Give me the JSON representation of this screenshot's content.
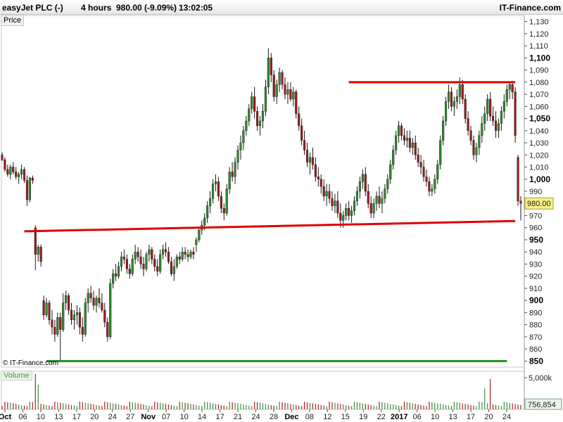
{
  "header": {
    "instrument": "easyJet PLC (-)",
    "timeframe": "4 hours",
    "quote": "980.00 (-9.09%)",
    "time": "13:02:05",
    "brand": "IT-Finance.com"
  },
  "panels": {
    "price_label": "Price",
    "volume_label": "Volume"
  },
  "copyright": "© IT-Finance.com",
  "colors": {
    "up": "#2f8a2f",
    "down": "#9b1c1c",
    "resistance": "#e00000",
    "support_green": "#1f8f1f",
    "current_price_box": "#f7f08a",
    "volume_box": "#eaf5ea"
  },
  "chart_data": {
    "type": "candlestick",
    "price_axis": {
      "min": 845,
      "max": 1135,
      "ticks": [
        850,
        860,
        870,
        880,
        890,
        900,
        910,
        920,
        930,
        940,
        950,
        960,
        970,
        980,
        990,
        1000,
        1010,
        1020,
        1030,
        1040,
        1050,
        1060,
        1070,
        1080,
        1090,
        1100,
        1110,
        1120,
        1130
      ],
      "tick_labels": [
        "850",
        "860",
        "870",
        "880",
        "890",
        "900",
        "910",
        "920",
        "930",
        "940",
        "950",
        "960",
        "970",
        "980",
        "990",
        "1,000",
        "1,010",
        "1,020",
        "1,030",
        "1,040",
        "1,050",
        "1,060",
        "1,070",
        "1,080",
        "1,090",
        "1,100",
        "1,110",
        "1,120",
        "1,130"
      ],
      "bold_ticks": [
        850,
        900,
        950,
        1000,
        1050,
        1100
      ]
    },
    "current_price": {
      "value": 980.0,
      "label": "980.00"
    },
    "date_axis": {
      "labels": [
        "Oct",
        "06",
        "10",
        "13",
        "17",
        "20",
        "24",
        "27",
        "Nov",
        "07",
        "10",
        "14",
        "17",
        "21",
        "24",
        "28",
        "Dec",
        "08",
        "12",
        "15",
        "19",
        "22",
        "2017",
        "06",
        "10",
        "13",
        "17",
        "20",
        "24"
      ],
      "bold": [
        "Oct",
        "Nov",
        "Dec",
        "2017"
      ]
    },
    "volume": {
      "axis_label": "5,000k",
      "current_label": "756,854",
      "max": 6000000
    },
    "trendlines": [
      {
        "name": "resistance",
        "color": "#e00000",
        "from": {
          "bar": 125,
          "price": 1080
        },
        "to": {
          "bar": 185,
          "price": 1080
        }
      },
      {
        "name": "support",
        "color": "#e00000",
        "from": {
          "bar": 8,
          "price": 957
        },
        "to": {
          "bar": 185,
          "price": 965.5
        }
      },
      {
        "name": "low-line",
        "color": "#1f8f1f",
        "from": {
          "bar": 16,
          "price": 850
        },
        "to": {
          "bar": 182,
          "price": 850
        }
      }
    ],
    "candles": [
      [
        1020,
        1022,
        1015,
        1016
      ],
      [
        1016,
        1018,
        1006,
        1008
      ],
      [
        1008,
        1012,
        1002,
        1004
      ],
      [
        1004,
        1012,
        1000,
        1010
      ],
      [
        1010,
        1014,
        1004,
        1006
      ],
      [
        1006,
        1010,
        1000,
        1002
      ],
      [
        1002,
        1006,
        996,
        1004
      ],
      [
        1004,
        1012,
        1000,
        1008
      ],
      [
        1008,
        1010,
        997,
        999
      ],
      [
        999,
        1003,
        978,
        983
      ],
      [
        983,
        1002,
        981,
        1001
      ],
      [
        1001,
        1003,
        996,
        999
      ],
      [
        960,
        962,
        925,
        938
      ],
      [
        938,
        946,
        932,
        944
      ],
      [
        944,
        946,
        928,
        932
      ],
      [
        900,
        904,
        884,
        888
      ],
      [
        888,
        902,
        886,
        898
      ],
      [
        898,
        900,
        880,
        884
      ],
      [
        884,
        892,
        872,
        878
      ],
      [
        878,
        884,
        866,
        872
      ],
      [
        872,
        890,
        870,
        886
      ],
      [
        886,
        890,
        850,
        876
      ],
      [
        876,
        906,
        874,
        898
      ],
      [
        898,
        908,
        892,
        904
      ],
      [
        904,
        906,
        888,
        892
      ],
      [
        892,
        898,
        880,
        884
      ],
      [
        884,
        892,
        876,
        888
      ],
      [
        888,
        896,
        880,
        890
      ],
      [
        890,
        894,
        872,
        878
      ],
      [
        878,
        886,
        866,
        872
      ],
      [
        872,
        902,
        870,
        898
      ],
      [
        898,
        910,
        890,
        906
      ],
      [
        906,
        912,
        898,
        902
      ],
      [
        902,
        908,
        892,
        896
      ],
      [
        896,
        904,
        890,
        902
      ],
      [
        902,
        910,
        894,
        898
      ],
      [
        898,
        906,
        890,
        892
      ],
      [
        892,
        898,
        878,
        882
      ],
      [
        882,
        886,
        866,
        870
      ],
      [
        870,
        918,
        868,
        914
      ],
      [
        914,
        926,
        910,
        922
      ],
      [
        922,
        930,
        916,
        920
      ],
      [
        920,
        932,
        918,
        928
      ],
      [
        928,
        940,
        924,
        936
      ],
      [
        936,
        942,
        930,
        934
      ],
      [
        934,
        938,
        922,
        926
      ],
      [
        926,
        930,
        918,
        922
      ],
      [
        922,
        938,
        920,
        934
      ],
      [
        934,
        946,
        930,
        940
      ],
      [
        940,
        944,
        932,
        936
      ],
      [
        936,
        942,
        926,
        930
      ],
      [
        930,
        936,
        920,
        926
      ],
      [
        926,
        940,
        924,
        938
      ],
      [
        938,
        946,
        932,
        942
      ],
      [
        942,
        944,
        930,
        934
      ],
      [
        934,
        938,
        924,
        928
      ],
      [
        928,
        934,
        920,
        924
      ],
      [
        924,
        942,
        922,
        938
      ],
      [
        938,
        946,
        934,
        942
      ],
      [
        942,
        948,
        936,
        940
      ],
      [
        940,
        944,
        930,
        932
      ],
      [
        932,
        936,
        920,
        922
      ],
      [
        922,
        934,
        916,
        928
      ],
      [
        928,
        938,
        926,
        936
      ],
      [
        936,
        940,
        930,
        934
      ],
      [
        934,
        944,
        932,
        940
      ],
      [
        940,
        944,
        934,
        938
      ],
      [
        938,
        942,
        932,
        936
      ],
      [
        936,
        942,
        934,
        940
      ],
      [
        940,
        944,
        934,
        938
      ],
      [
        946,
        952,
        940,
        950
      ],
      [
        950,
        960,
        948,
        958
      ],
      [
        958,
        966,
        954,
        962
      ],
      [
        962,
        972,
        958,
        968
      ],
      [
        968,
        982,
        964,
        978
      ],
      [
        978,
        990,
        972,
        984
      ],
      [
        984,
        1000,
        980,
        996
      ],
      [
        996,
        1004,
        990,
        998
      ],
      [
        998,
        1002,
        982,
        986
      ],
      [
        986,
        990,
        972,
        976
      ],
      [
        976,
        980,
        966,
        972
      ],
      [
        972,
        996,
        970,
        992
      ],
      [
        992,
        1010,
        988,
        1006
      ],
      [
        1006,
        1014,
        998,
        1002
      ],
      [
        1002,
        1018,
        996,
        1014
      ],
      [
        1014,
        1028,
        1008,
        1024
      ],
      [
        1024,
        1036,
        1016,
        1030
      ],
      [
        1030,
        1044,
        1024,
        1040
      ],
      [
        1040,
        1052,
        1036,
        1048
      ],
      [
        1048,
        1062,
        1044,
        1058
      ],
      [
        1058,
        1072,
        1054,
        1068
      ],
      [
        1068,
        1076,
        1050,
        1056
      ],
      [
        1056,
        1060,
        1040,
        1044
      ],
      [
        1044,
        1052,
        1036,
        1048
      ],
      [
        1048,
        1062,
        1042,
        1056
      ],
      [
        1056,
        1082,
        1052,
        1076
      ],
      [
        1076,
        1108,
        1070,
        1100
      ],
      [
        1100,
        1104,
        1080,
        1086
      ],
      [
        1086,
        1090,
        1064,
        1068
      ],
      [
        1068,
        1082,
        1062,
        1078
      ],
      [
        1078,
        1092,
        1072,
        1088
      ],
      [
        1088,
        1090,
        1074,
        1078
      ],
      [
        1078,
        1084,
        1066,
        1070
      ],
      [
        1070,
        1080,
        1062,
        1074
      ],
      [
        1074,
        1080,
        1064,
        1066
      ],
      [
        1066,
        1076,
        1060,
        1072
      ],
      [
        1072,
        1074,
        1050,
        1054
      ],
      [
        1054,
        1060,
        1040,
        1044
      ],
      [
        1044,
        1050,
        1028,
        1032
      ],
      [
        1032,
        1040,
        1020,
        1024
      ],
      [
        1024,
        1030,
        1010,
        1014
      ],
      [
        1014,
        1022,
        1004,
        1018
      ],
      [
        1018,
        1026,
        1008,
        1012
      ],
      [
        1012,
        1018,
        998,
        1002
      ],
      [
        1002,
        1010,
        994,
        1000
      ],
      [
        1000,
        1004,
        988,
        994
      ],
      [
        994,
        1000,
        982,
        986
      ],
      [
        986,
        996,
        978,
        990
      ],
      [
        990,
        996,
        980,
        984
      ],
      [
        984,
        990,
        974,
        978
      ],
      [
        978,
        988,
        972,
        982
      ],
      [
        982,
        990,
        968,
        972
      ],
      [
        972,
        980,
        960,
        966
      ],
      [
        966,
        974,
        960,
        970
      ],
      [
        970,
        980,
        966,
        976
      ],
      [
        976,
        982,
        966,
        970
      ],
      [
        970,
        978,
        964,
        974
      ],
      [
        974,
        986,
        970,
        982
      ],
      [
        982,
        994,
        978,
        990
      ],
      [
        990,
        1002,
        984,
        998
      ],
      [
        998,
        1008,
        992,
        1004
      ],
      [
        1004,
        1010,
        986,
        990
      ],
      [
        990,
        996,
        976,
        980
      ],
      [
        980,
        986,
        968,
        972
      ],
      [
        972,
        984,
        968,
        980
      ],
      [
        980,
        990,
        974,
        986
      ],
      [
        986,
        994,
        976,
        980
      ],
      [
        980,
        990,
        972,
        984
      ],
      [
        984,
        996,
        980,
        992
      ],
      [
        992,
        1004,
        988,
        1000
      ],
      [
        1000,
        1016,
        996,
        1012
      ],
      [
        1012,
        1028,
        1008,
        1024
      ],
      [
        1024,
        1040,
        1020,
        1036
      ],
      [
        1036,
        1048,
        1030,
        1044
      ],
      [
        1044,
        1046,
        1032,
        1036
      ],
      [
        1036,
        1042,
        1028,
        1032
      ],
      [
        1032,
        1040,
        1026,
        1034
      ],
      [
        1034,
        1040,
        1022,
        1026
      ],
      [
        1026,
        1034,
        1020,
        1030
      ],
      [
        1030,
        1036,
        1016,
        1020
      ],
      [
        1020,
        1026,
        1010,
        1014
      ],
      [
        1014,
        1020,
        1004,
        1010
      ],
      [
        1010,
        1016,
        998,
        1002
      ],
      [
        1002,
        1008,
        994,
        998
      ],
      [
        998,
        1002,
        986,
        990
      ],
      [
        990,
        996,
        986,
        992
      ],
      [
        992,
        1004,
        988,
        1000
      ],
      [
        1000,
        1016,
        996,
        1012
      ],
      [
        1012,
        1036,
        1008,
        1032
      ],
      [
        1032,
        1052,
        1028,
        1048
      ],
      [
        1048,
        1068,
        1044,
        1064
      ],
      [
        1064,
        1078,
        1058,
        1072
      ],
      [
        1072,
        1076,
        1056,
        1060
      ],
      [
        1060,
        1068,
        1052,
        1064
      ],
      [
        1064,
        1074,
        1058,
        1068
      ],
      [
        1068,
        1084,
        1062,
        1078
      ],
      [
        1078,
        1082,
        1062,
        1066
      ],
      [
        1066,
        1070,
        1046,
        1050
      ],
      [
        1050,
        1056,
        1036,
        1040
      ],
      [
        1040,
        1044,
        1028,
        1032
      ],
      [
        1032,
        1036,
        1016,
        1020
      ],
      [
        1020,
        1030,
        1014,
        1026
      ],
      [
        1026,
        1040,
        1020,
        1036
      ],
      [
        1036,
        1052,
        1030,
        1046
      ],
      [
        1046,
        1060,
        1040,
        1054
      ],
      [
        1054,
        1070,
        1048,
        1066
      ],
      [
        1066,
        1072,
        1048,
        1052
      ],
      [
        1052,
        1060,
        1044,
        1048
      ],
      [
        1048,
        1056,
        1034,
        1040
      ],
      [
        1040,
        1050,
        1034,
        1046
      ],
      [
        1046,
        1060,
        1040,
        1056
      ],
      [
        1056,
        1070,
        1050,
        1064
      ],
      [
        1064,
        1078,
        1060,
        1074
      ],
      [
        1074,
        1080,
        1066,
        1078
      ],
      [
        1078,
        1080,
        1066,
        1072
      ],
      [
        1072,
        1076,
        1030,
        1036
      ],
      [
        1018,
        1020,
        978,
        982
      ],
      [
        982,
        986,
        966,
        980
      ]
    ]
  }
}
